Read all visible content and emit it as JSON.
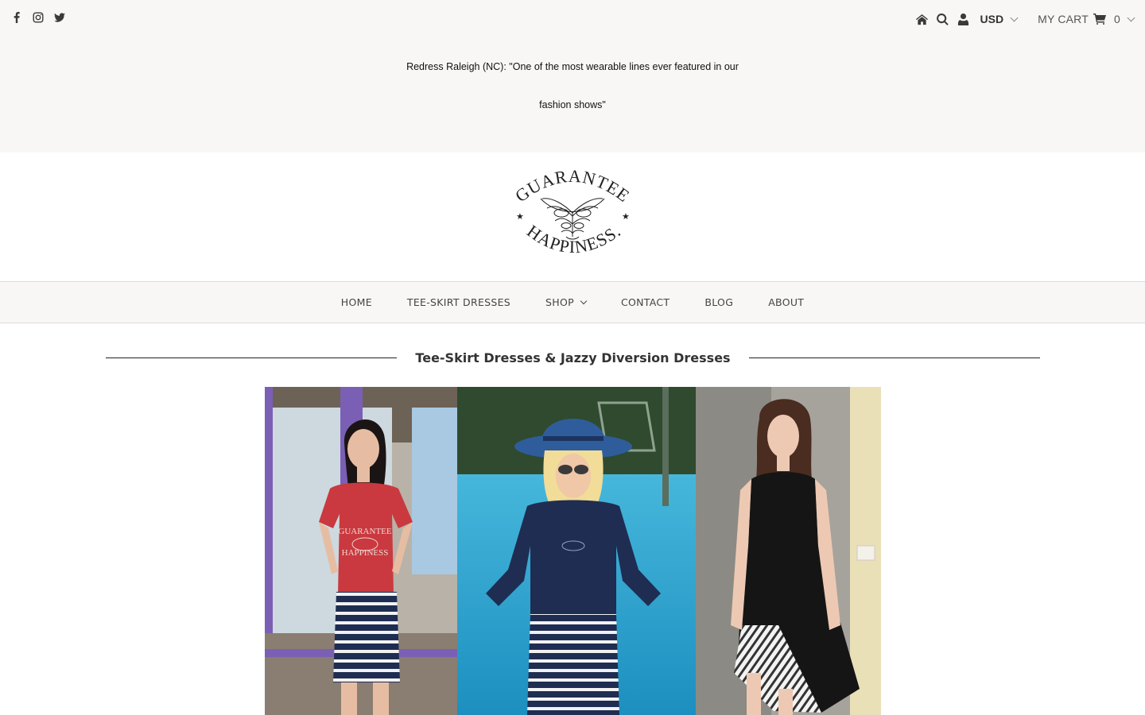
{
  "topbar": {
    "social_icons": [
      "facebook-icon",
      "instagram-icon",
      "twitter-icon"
    ],
    "util_icons": [
      "home-icon",
      "search-icon",
      "user-icon"
    ],
    "currency": "USD",
    "cart_label": "MY CART",
    "cart_count": "0"
  },
  "announcement": {
    "text": "Redress Raleigh (NC): \"One of the most wearable lines ever featured in our fashion shows\""
  },
  "logo": {
    "top_text": "GUARANTEE",
    "bottom_text": "HAPPINESS."
  },
  "nav": {
    "items": [
      "HOME",
      "TEE-SKIRT DRESSES",
      "SHOP",
      "CONTACT",
      "BLOG",
      "ABOUT"
    ]
  },
  "section": {
    "title": "Tee-Skirt Dresses & Jazzy Diversion Dresses"
  },
  "hero": {
    "shirt_text_top": "GUARANTEE",
    "shirt_text_bottom": "HAPPINESS"
  },
  "colors": {
    "topbar_bg": "#f8f7f6",
    "icon": "#3a3a3a",
    "navy": "#1f2d52",
    "red_tee": "#c9393f",
    "pool": "#2aa7cf"
  }
}
